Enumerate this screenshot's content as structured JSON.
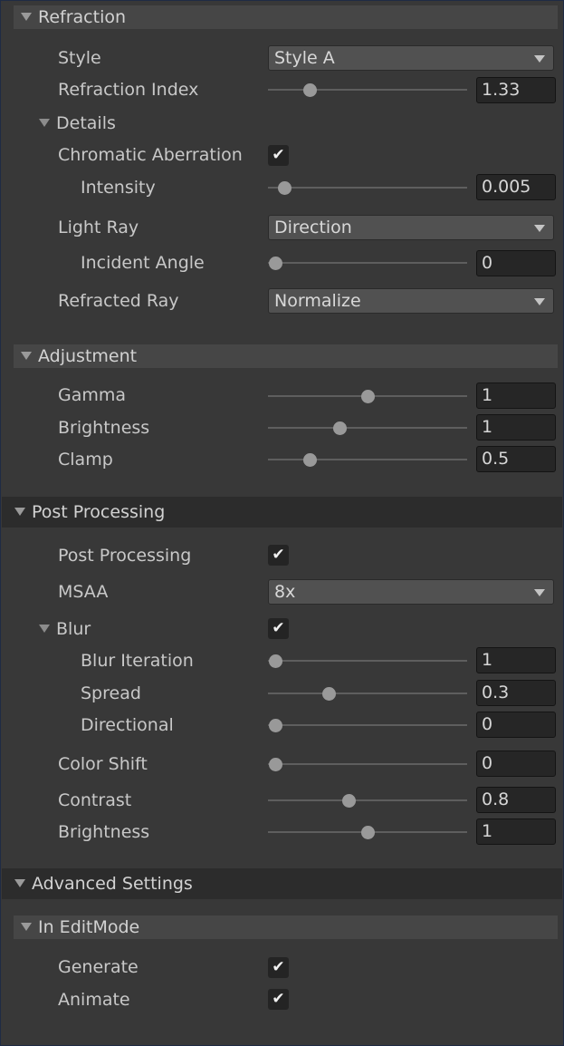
{
  "refraction": {
    "header": "Refraction",
    "style": {
      "label": "Style",
      "value": "Style A"
    },
    "refraction_index": {
      "label": "Refraction Index",
      "value": "1.33",
      "fraction": 0.19
    },
    "details": {
      "label": "Details"
    },
    "chromatic_aberration": {
      "label": "Chromatic Aberration",
      "checked": true
    },
    "intensity": {
      "label": "Intensity",
      "value": "0.005",
      "fraction": 0.05
    },
    "light_ray": {
      "label": "Light Ray",
      "value": "Direction"
    },
    "incident_angle": {
      "label": "Incident Angle",
      "value": "0",
      "fraction": 0.0
    },
    "refracted_ray": {
      "label": "Refracted Ray",
      "value": "Normalize"
    }
  },
  "adjustment": {
    "header": "Adjustment",
    "gamma": {
      "label": "Gamma",
      "value": "1",
      "fraction": 0.5
    },
    "brightness": {
      "label": "Brightness",
      "value": "1",
      "fraction": 0.35
    },
    "clamp": {
      "label": "Clamp",
      "value": "0.5",
      "fraction": 0.19
    }
  },
  "post_processing": {
    "header": "Post Processing",
    "post_processing": {
      "label": "Post Processing",
      "checked": true
    },
    "msaa": {
      "label": "MSAA",
      "value": "8x"
    },
    "blur": {
      "label": "Blur",
      "checked": true
    },
    "blur_iteration": {
      "label": "Blur Iteration",
      "value": "1",
      "fraction": 0.0
    },
    "spread": {
      "label": "Spread",
      "value": "0.3",
      "fraction": 0.29
    },
    "directional": {
      "label": "Directional",
      "value": "0",
      "fraction": 0.0
    },
    "color_shift": {
      "label": "Color Shift",
      "value": "0",
      "fraction": 0.0
    },
    "contrast": {
      "label": "Contrast",
      "value": "0.8",
      "fraction": 0.4
    },
    "brightness": {
      "label": "Brightness",
      "value": "1",
      "fraction": 0.5
    }
  },
  "advanced_settings": {
    "header": "Advanced Settings"
  },
  "in_editmode": {
    "header": "In EditMode",
    "generate": {
      "label": "Generate",
      "checked": true
    },
    "animate": {
      "label": "Animate",
      "checked": true
    }
  },
  "icons": {
    "checkmark": "✔",
    "foldout": "triangle-down-icon",
    "dropdown": "chevron-down-icon"
  },
  "colors": {
    "background": "#383838",
    "header": "#464646",
    "section_header": "#2c2c2c",
    "field": "#262626",
    "knob": "#999999"
  }
}
